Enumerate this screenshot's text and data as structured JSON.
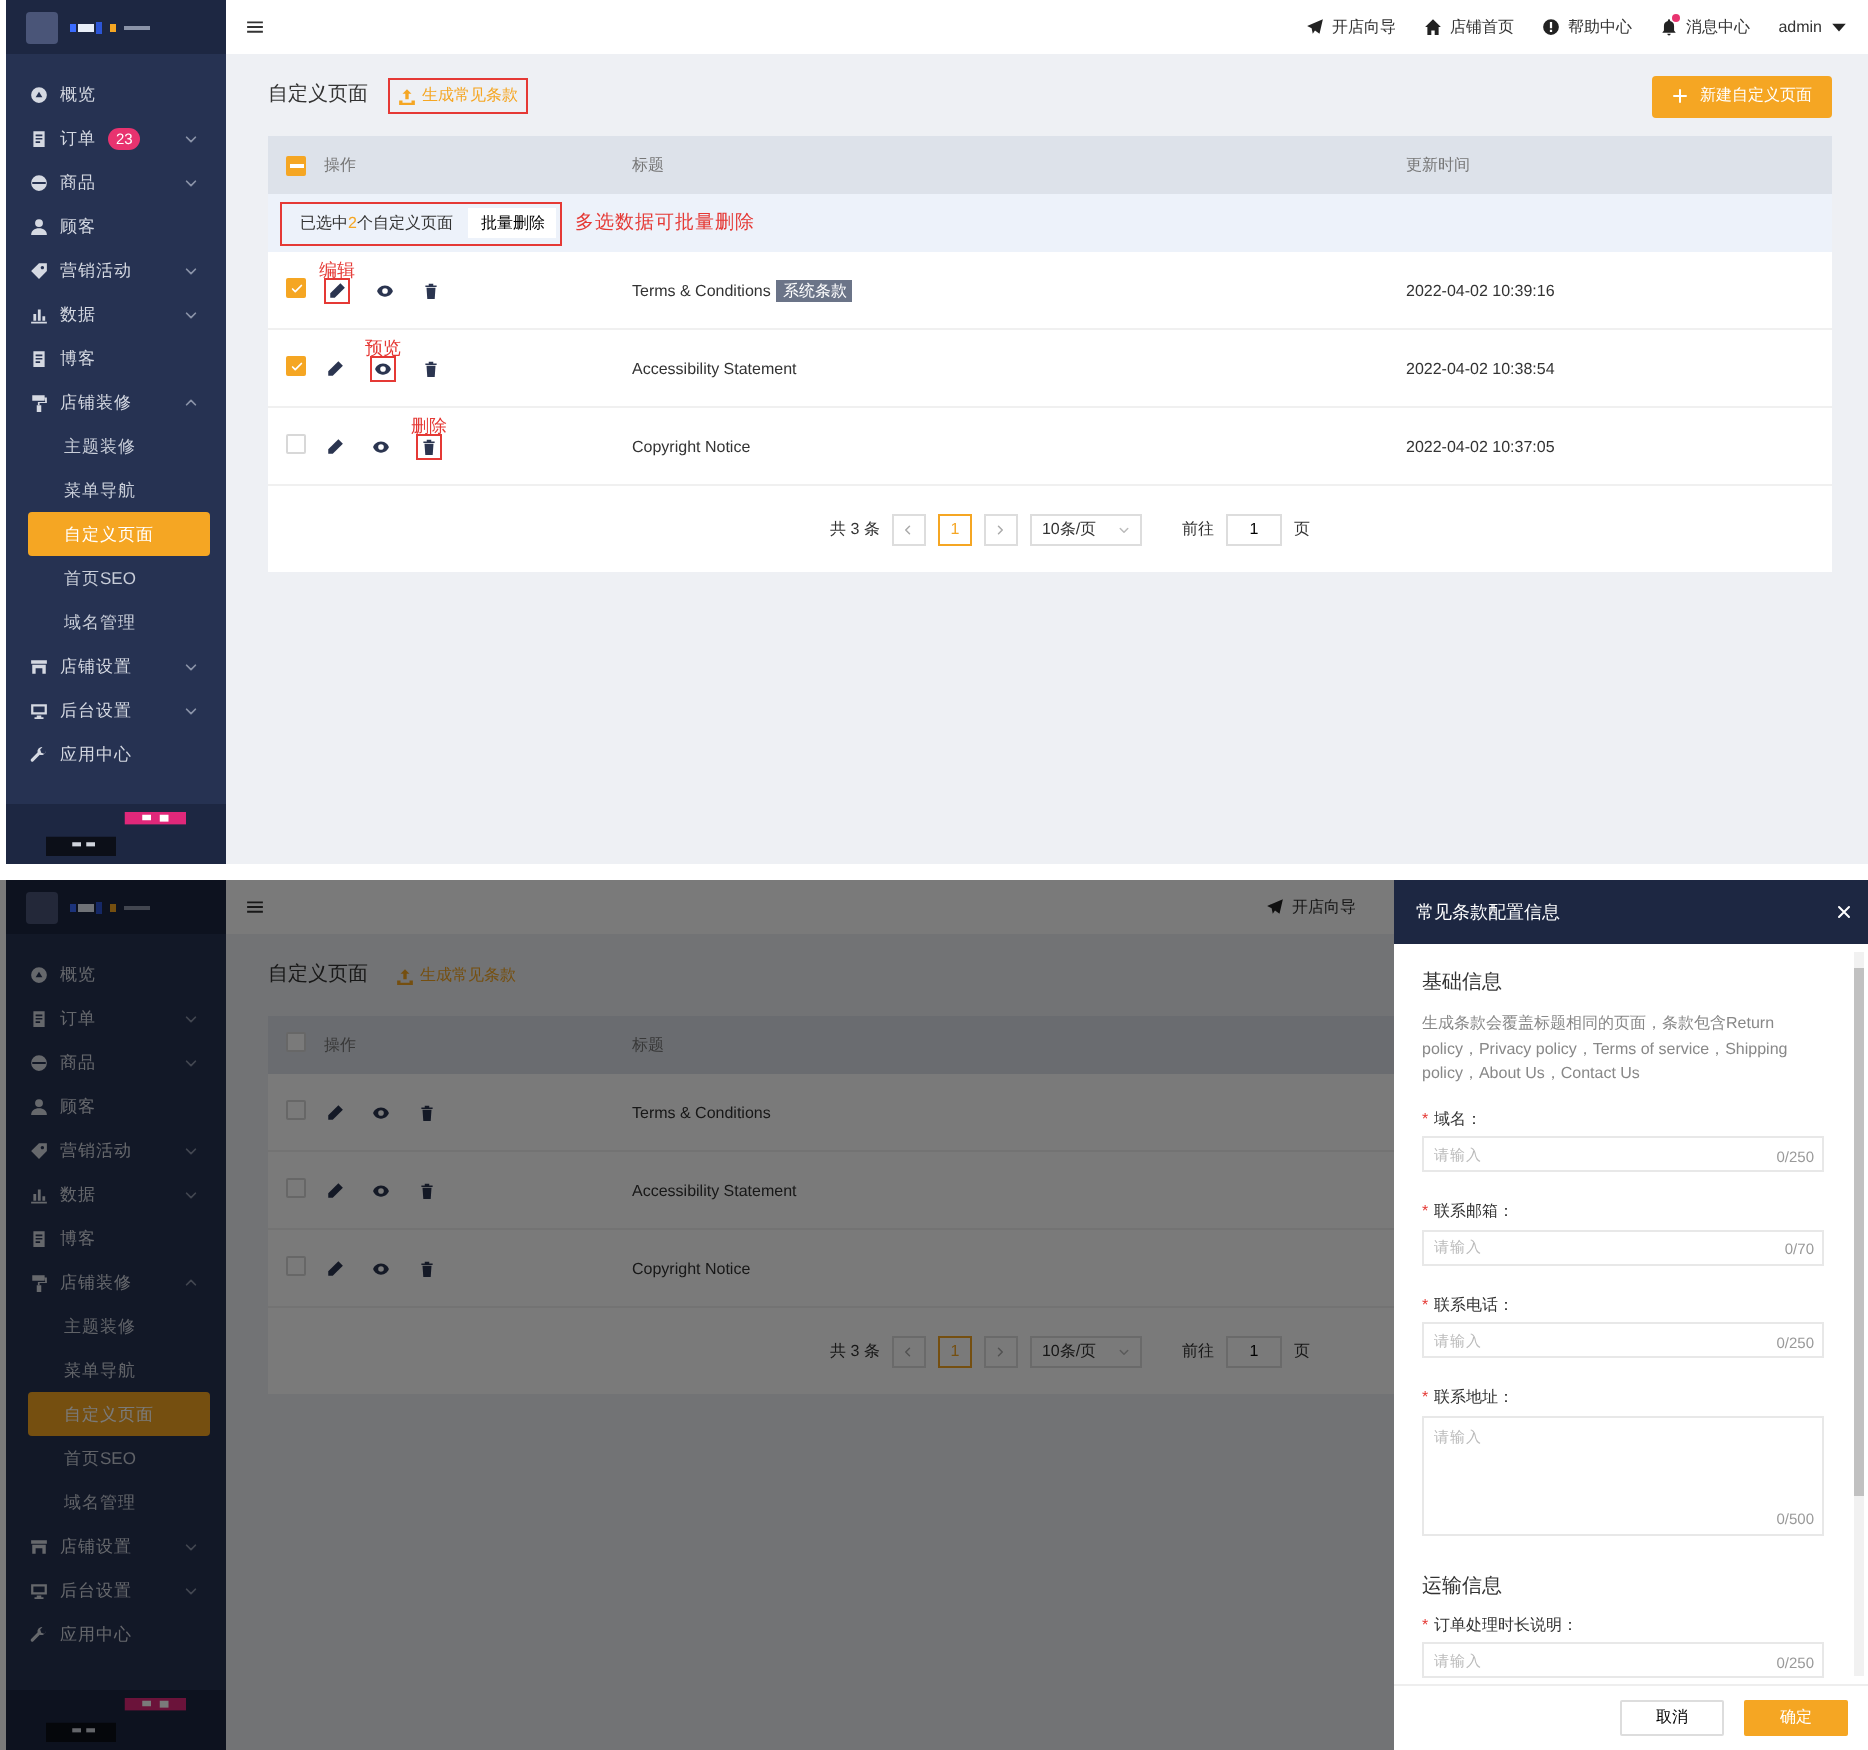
{
  "screens": [
    {
      "sidebar": {
        "items": [
          {
            "label": "概览",
            "selected": false
          },
          {
            "label": "订单",
            "badge": "23",
            "expanded": false,
            "selected": false
          },
          {
            "label": "商品",
            "expanded": false,
            "selected": false
          },
          {
            "label": "顾客",
            "selected": false
          },
          {
            "label": "营销活动",
            "expanded": false,
            "selected": false
          },
          {
            "label": "数据",
            "expanded": false,
            "selected": false
          },
          {
            "label": "博客",
            "selected": false
          },
          {
            "label": "店铺装修",
            "expanded": true,
            "selected": false,
            "children": [
              {
                "label": "主题装修",
                "selected": false
              },
              {
                "label": "菜单导航",
                "selected": false
              },
              {
                "label": "自定义页面",
                "selected": true
              },
              {
                "label": "首页SEO",
                "selected": false
              },
              {
                "label": "域名管理",
                "selected": false
              }
            ]
          },
          {
            "label": "店铺设置",
            "expanded": false,
            "selected": false
          },
          {
            "label": "后台设置",
            "expanded": false,
            "selected": false
          },
          {
            "label": "应用中心",
            "selected": false
          }
        ]
      },
      "header": {
        "nav": [
          {
            "label": "开店向导"
          },
          {
            "label": "店铺首页"
          },
          {
            "label": "帮助中心"
          },
          {
            "label": "消息中心",
            "unread": true
          }
        ],
        "user": "admin"
      },
      "content": {
        "title": "自定义页面",
        "generate": {
          "label": "生成常见条款",
          "highlighted": true
        },
        "new_button": "新建自定义页面",
        "select_all": {
          "indeterminate": true
        },
        "columns": [
          "操作",
          "标题",
          "更新时间"
        ],
        "selection": {
          "prefix": "已选中",
          "count": "2",
          "suffix": "个自定义页面",
          "action": "批量删除",
          "highlighted": true,
          "note": "多选数据可批量删除"
        },
        "rows": [
          {
            "checked": true,
            "title": "Terms & Conditions",
            "tag": "系统条款",
            "updated": "2022-04-02 10:39:16",
            "actions": [
              {
                "highlighted": true,
                "note": "编辑"
              },
              {
                "highlighted": false
              },
              {
                "highlighted": false
              }
            ]
          },
          {
            "checked": true,
            "title": "Accessibility Statement",
            "updated": "2022-04-02 10:38:54",
            "actions": [
              {
                "highlighted": false
              },
              {
                "highlighted": true,
                "note": "预览"
              },
              {
                "highlighted": false
              }
            ]
          },
          {
            "checked": false,
            "title": "Copyright Notice",
            "updated": "2022-04-02 10:37:05",
            "actions": [
              {
                "highlighted": false
              },
              {
                "highlighted": false
              },
              {
                "highlighted": true,
                "note": "删除"
              }
            ]
          }
        ],
        "pagination": {
          "total": "共 3 条",
          "pages": [
            {
              "label": "1",
              "selected": true
            }
          ],
          "page_size": "10条/页",
          "goto_label": "前往",
          "goto_value": "1",
          "goto_suffix": "页"
        }
      }
    },
    {
      "sidebar": {
        "items": [
          {
            "label": "概览",
            "selected": false
          },
          {
            "label": "订单",
            "expanded": false,
            "selected": false
          },
          {
            "label": "商品",
            "expanded": false,
            "selected": false
          },
          {
            "label": "顾客",
            "selected": false
          },
          {
            "label": "营销活动",
            "expanded": false,
            "selected": false
          },
          {
            "label": "数据",
            "expanded": false,
            "selected": false
          },
          {
            "label": "博客",
            "selected": false
          },
          {
            "label": "店铺装修",
            "expanded": true,
            "selected": false,
            "children": [
              {
                "label": "主题装修",
                "selected": false
              },
              {
                "label": "菜单导航",
                "selected": false
              },
              {
                "label": "自定义页面",
                "selected": true
              },
              {
                "label": "首页SEO",
                "selected": false
              },
              {
                "label": "域名管理",
                "selected": false
              }
            ]
          },
          {
            "label": "店铺设置",
            "expanded": false,
            "selected": false
          },
          {
            "label": "后台设置",
            "expanded": false,
            "selected": false
          },
          {
            "label": "应用中心",
            "selected": false
          }
        ]
      },
      "header": {
        "nav": [
          {
            "label": "开店向导"
          }
        ]
      },
      "content": {
        "title": "自定义页面",
        "generate": {
          "label": "生成常见条款",
          "highlighted": false
        },
        "select_all": {
          "indeterminate": false
        },
        "columns": [
          "操作",
          "标题"
        ],
        "rows": [
          {
            "checked": false,
            "title": "Terms & Conditions",
            "actions": [
              {
                "highlighted": false
              },
              {
                "highlighted": false
              },
              {
                "highlighted": false
              }
            ]
          },
          {
            "checked": false,
            "title": "Accessibility Statement",
            "actions": [
              {
                "highlighted": false
              },
              {
                "highlighted": false
              },
              {
                "highlighted": false
              }
            ]
          },
          {
            "checked": false,
            "title": "Copyright Notice",
            "actions": [
              {
                "highlighted": false
              },
              {
                "highlighted": false
              },
              {
                "highlighted": false
              }
            ]
          }
        ],
        "pagination": {
          "total": "共 3 条",
          "pages": [
            {
              "label": "1",
              "selected": true
            }
          ],
          "page_size": "10条/页",
          "goto_label": "前往",
          "goto_value": "1",
          "goto_suffix": "页"
        }
      },
      "drawer": {
        "title": "常见条款配置信息",
        "sections": [
          {
            "title": "基础信息",
            "description": "生成条款会覆盖标题相同的页面，条款包含Return policy，Privacy policy，Terms of service，Shipping policy，About Us，Contact Us",
            "fields": [
              {
                "kind": "input",
                "required_mark": "*",
                "label": "域名：",
                "placeholder": "请输入",
                "counter": "0/250"
              },
              {
                "kind": "input",
                "required_mark": "*",
                "label": "联系邮箱：",
                "placeholder": "请输入",
                "counter": "0/70"
              },
              {
                "kind": "input",
                "required_mark": "*",
                "label": "联系电话：",
                "placeholder": "请输入",
                "counter": "0/250"
              },
              {
                "kind": "textarea",
                "required_mark": "*",
                "label": "联系地址：",
                "placeholder": "请输入",
                "counter": "0/500"
              }
            ]
          },
          {
            "title": "运输信息",
            "fields": [
              {
                "kind": "input",
                "required_mark": "*",
                "label": "订单处理时长说明：",
                "placeholder": "请输入",
                "counter": "0/250"
              }
            ]
          }
        ],
        "buttons": [
          {
            "label": "取消",
            "primary": false
          },
          {
            "label": "确定",
            "primary": true
          }
        ]
      }
    }
  ]
}
